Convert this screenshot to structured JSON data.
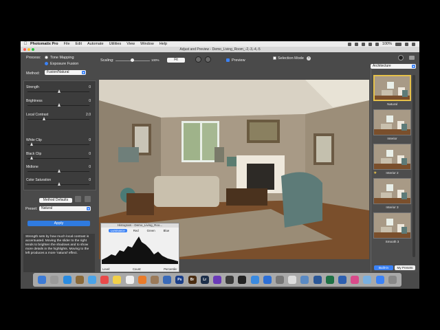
{
  "menubar": {
    "app": "Photomatix Pro",
    "items": [
      "File",
      "Edit",
      "Automate",
      "Utilities",
      "View",
      "Window",
      "Help"
    ],
    "battery": "100%"
  },
  "window": {
    "title": "Adjust and Preview - Demo_Living_Room_-2,-3,-4,-5"
  },
  "toolbar": {
    "process_label": "Process:",
    "tone_mapping": "Tone Mapping",
    "exposure_fusion": "Exposure Fusion",
    "method_label": "Method:",
    "method_value": "Fusion/Natural",
    "scaling_label": "Scaling:",
    "scaling_value": "100%",
    "fit_label": "Fit",
    "preview_label": "Preview",
    "selection_mode_label": "Selection Mode",
    "preset_category": "Architecture"
  },
  "sliders": [
    {
      "name": "Strength",
      "value": "0",
      "fraction": 0.5
    },
    {
      "name": "Brightness",
      "value": "0",
      "fraction": 0.5
    },
    {
      "name": "Local Contrast",
      "value": "2.0",
      "fraction": 0.25
    },
    {
      "name": "White Clip",
      "value": "0",
      "fraction": 0.05
    },
    {
      "name": "Black Clip",
      "value": "0",
      "fraction": 0.05
    },
    {
      "name": "Midtone",
      "value": "0",
      "fraction": 0.5
    },
    {
      "name": "Color Saturation",
      "value": "0",
      "fraction": 0.5
    }
  ],
  "method_defaults": "Method Defaults",
  "preset": {
    "label": "Preset:",
    "value": "Natural"
  },
  "apply_label": "Apply",
  "description": "Strength sets by how much local contrast is accentuated. Moving the slider to the right tends to brighten the shadows and to show more details in the highlights. Moving to the left produces a more 'natural' effect.",
  "histogram": {
    "title": "Histogram - Demo_Living_Roo...",
    "tabs": [
      "Luminance",
      "Red",
      "Green",
      "Blue"
    ],
    "active_tab": "Luminance",
    "footer": [
      "Level:",
      "Count:",
      "Percentile:"
    ]
  },
  "presets": [
    {
      "label": "Natural",
      "selected": true,
      "starred": false
    },
    {
      "label": "Interior",
      "selected": false,
      "starred": false
    },
    {
      "label": "Interior 2",
      "selected": false,
      "starred": true
    },
    {
      "label": "Interior 3",
      "selected": false,
      "starred": false
    },
    {
      "label": "Smooth 3",
      "selected": false,
      "starred": false
    }
  ],
  "right_tabs": {
    "builtin": "Built-in",
    "my_presets": "My Presets"
  },
  "colors": {
    "accent": "#3b82f6",
    "panel": "#4a4a4a",
    "selection": "#e6c14a"
  },
  "dock_icons": [
    "finder-icon",
    "launchpad-icon",
    "safari-icon",
    "photos-icon",
    "mail-icon",
    "calendar-icon",
    "notes-icon",
    "reminders-icon",
    "photos2-icon",
    "contacts-icon",
    "app-icon",
    "photoshop-icon",
    "bridge-icon",
    "lightroom-icon",
    "effects-icon",
    "photomatix-icon",
    "terminal-icon",
    "preview-icon",
    "appstore-icon",
    "sysprefs-icon",
    "app2-icon",
    "folder-icon",
    "word-icon",
    "excel-icon",
    "keynote-icon",
    "itunes-icon",
    "files-icon",
    "info-icon",
    "trash-icon"
  ]
}
